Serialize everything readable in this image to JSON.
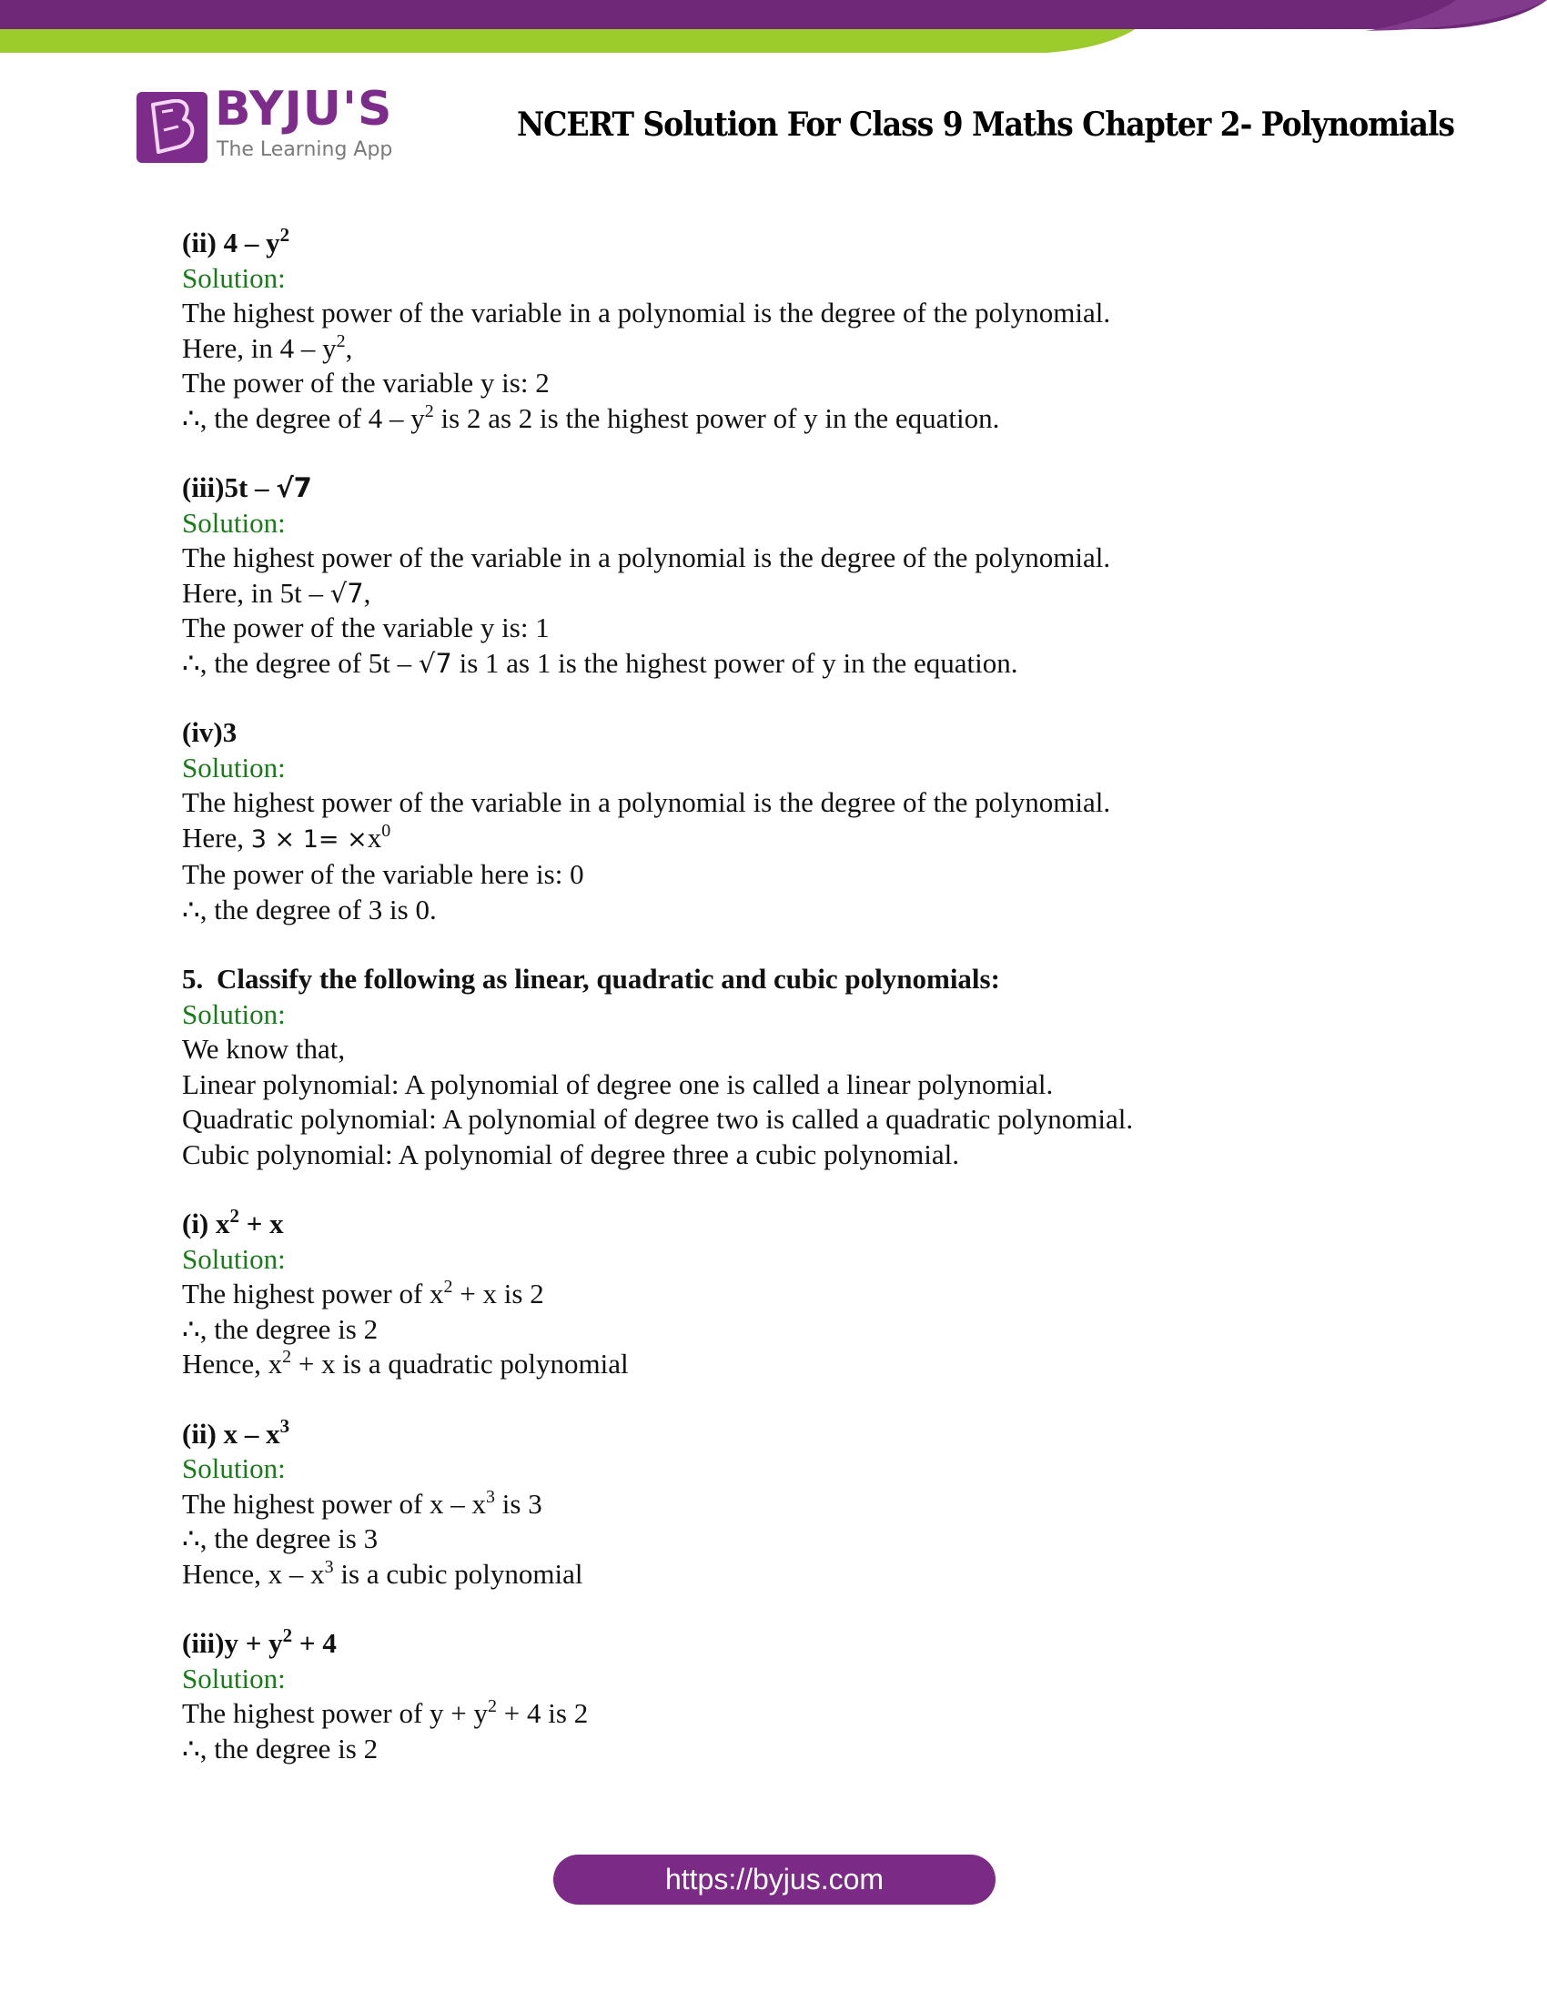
{
  "header": {
    "brand_name": "BYJU'S",
    "brand_tagline": "The Learning App",
    "logo_letter": "B",
    "title": "NCERT Solution For Class 9 Maths Chapter 2- Polynomials",
    "colors": {
      "purple": "#6f2878",
      "purple_light": "#823a8c",
      "green": "#9ccb2c",
      "solution_green": "#1a7a1a"
    }
  },
  "sections": {
    "q4_ii": {
      "label": "(ii) 4 – y",
      "label_sup": "2",
      "solution": "Solution:",
      "l1": "The highest power of the variable in a polynomial is the degree of the polynomial.",
      "l2_pre": "Here, in 4 – y",
      "l2_sup": "2",
      "l2_post": ",",
      "l3": "The power of the variable y is: 2",
      "l4_pre": "∴, the degree of 4 – y",
      "l4_sup": "2",
      "l4_post": " is 2 as 2 is the highest power of y in the equation."
    },
    "q4_iii": {
      "label": "(iii)5t – ",
      "label_rad": "√7",
      "solution": "Solution:",
      "l1": "The highest power of the variable in a polynomial is the degree of the polynomial.",
      "l2_pre": "Here, in 5t – ",
      "l2_rad": "√7",
      "l2_post": ",",
      "l3": "The power of the variable y is: 1",
      "l4_pre": "∴, the degree of 5t – ",
      "l4_rad": "√7",
      "l4_post": " is 1 as 1 is the highest power of y in the equation."
    },
    "q4_iv": {
      "label": "(iv)3",
      "solution": "Solution:",
      "l1": "The highest power of the variable in a polynomial is the degree of the polynomial.",
      "l2_pre": "Here, ",
      "l2_math": "3 × 1= ×",
      "l2_x": "x",
      "l2_sup": "0",
      "l3": "The power of the variable here is: 0",
      "l4": "∴, the degree of 3 is 0."
    },
    "q5": {
      "number": "5.",
      "question": "Classify the following as linear, quadratic and cubic polynomials:",
      "solution": "Solution:",
      "l1": "We know that,",
      "l2": "Linear polynomial: A polynomial of degree one is called a linear polynomial.",
      "l3": "Quadratic polynomial: A polynomial of degree two is called a quadratic polynomial.",
      "l4": "Cubic polynomial: A polynomial of degree three a cubic polynomial."
    },
    "q5_i": {
      "label_pre": "(i)  x",
      "label_sup": "2",
      "label_post": " + x",
      "solution": "Solution:",
      "l1_pre": "The highest power of x",
      "l1_sup": "2",
      "l1_post": " + x is 2",
      "l2": "∴, the degree is 2",
      "l3_pre": "Hence, x",
      "l3_sup": "2",
      "l3_post": " + x is a quadratic polynomial"
    },
    "q5_ii": {
      "label_pre": "(ii) x – x",
      "label_sup": "3",
      "solution": "Solution:",
      "l1_pre": "The highest power of x – x",
      "l1_sup": "3",
      "l1_post": " is 3",
      "l2": "∴, the degree is 3",
      "l3_pre": "Hence, x – x",
      "l3_sup": "3",
      "l3_post": " is a cubic polynomial"
    },
    "q5_iii": {
      "label_pre": "(iii)y + y",
      "label_sup": "2",
      "label_post": " + 4",
      "solution": "Solution:",
      "l1_pre": "The highest power of y + y",
      "l1_sup": "2",
      "l1_post": " + 4 is 2",
      "l2": "∴, the degree is 2"
    }
  },
  "footer": {
    "url": "https://byjus.com"
  }
}
